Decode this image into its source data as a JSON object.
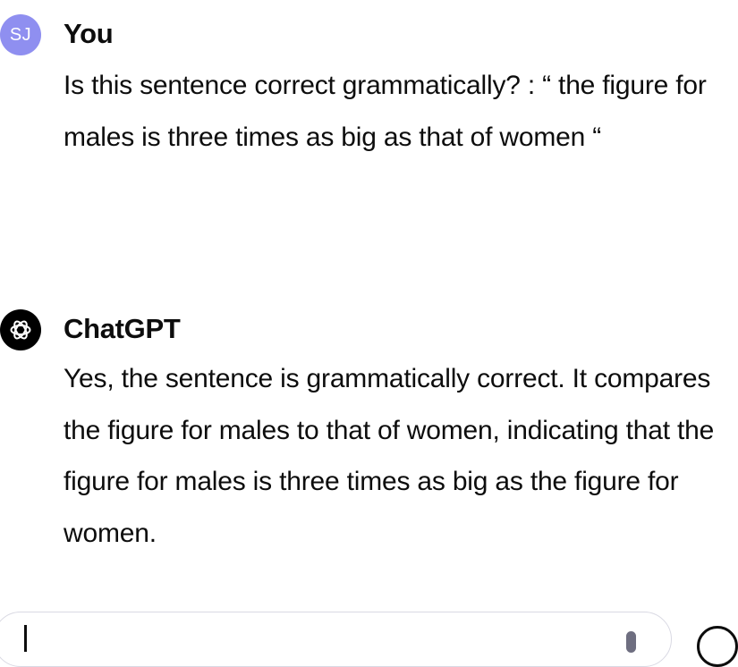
{
  "conversation": {
    "user": {
      "avatar_initials": "SJ",
      "author": "You",
      "text": "Is this sentence correct grammatically? : “ the figure for males is three times as big as that of women “"
    },
    "assistant": {
      "avatar_icon": "openai-logo-icon",
      "author": "ChatGPT",
      "text": "Yes, the sentence is grammatically correct. It compares the figure for males to that of women, indicating that the figure for males is three times as big as the figure for women."
    }
  },
  "composer": {
    "value": "",
    "icons": [
      "mic-icon",
      "send-icon"
    ]
  },
  "colors": {
    "user_avatar": "#8f8ff0",
    "assistant_avatar": "#000000",
    "text": "#0d0d0d"
  }
}
